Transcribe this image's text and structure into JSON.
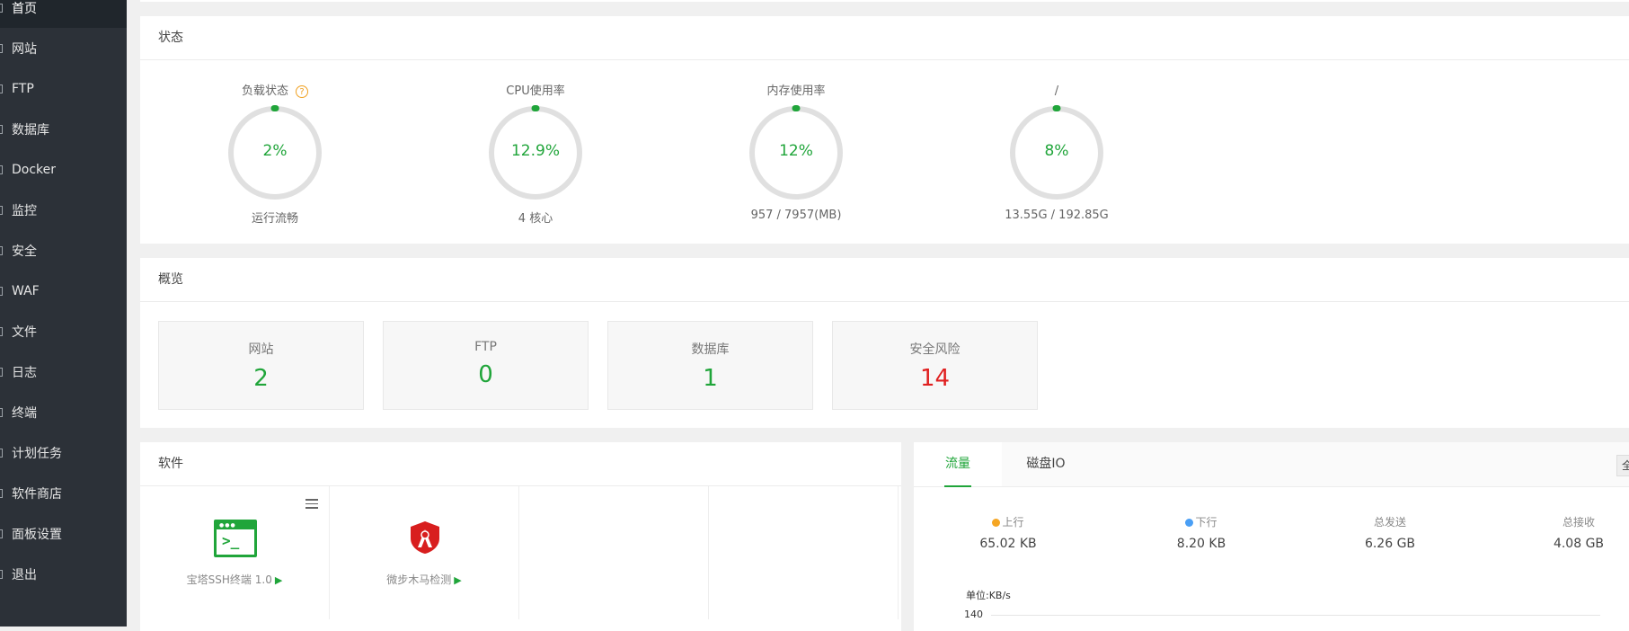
{
  "sidebar": {
    "items": [
      {
        "label": "首页",
        "active": true
      },
      {
        "label": "网站"
      },
      {
        "label": "FTP"
      },
      {
        "label": "数据库"
      },
      {
        "label": "Docker"
      },
      {
        "label": "监控"
      },
      {
        "label": "安全"
      },
      {
        "label": "WAF"
      },
      {
        "label": "文件"
      },
      {
        "label": "日志"
      },
      {
        "label": "终端"
      },
      {
        "label": "计划任务"
      },
      {
        "label": "软件商店"
      },
      {
        "label": "面板设置"
      },
      {
        "label": "退出"
      }
    ]
  },
  "status": {
    "title": "状态",
    "gauges": [
      {
        "title": "负载状态",
        "help": "?",
        "value": "2%",
        "sub": "运行流畅"
      },
      {
        "title": "CPU使用率",
        "value": "12.9%",
        "sub": "4 核心"
      },
      {
        "title": "内存使用率",
        "value": "12%",
        "sub": "957 / 7957(MB)"
      },
      {
        "title": "/",
        "value": "8%",
        "sub": "13.55G / 192.85G"
      }
    ]
  },
  "overview": {
    "title": "概览",
    "boxes": [
      {
        "label": "网站",
        "value": "2"
      },
      {
        "label": "FTP",
        "value": "0"
      },
      {
        "label": "数据库",
        "value": "1"
      },
      {
        "label": "安全风险",
        "value": "14",
        "color": "#e02020"
      }
    ]
  },
  "software": {
    "title": "软件",
    "items": [
      {
        "name": "宝塔SSH终端 1.0",
        "icon": "terminal-icon"
      },
      {
        "name": "微步木马检测",
        "icon": "shield-icon"
      }
    ]
  },
  "traffic": {
    "tabs": [
      "流量",
      "磁盘IO"
    ],
    "corner": "全",
    "stats": [
      {
        "label": "上行",
        "value": "65.02 KB",
        "bullet": "#f5a623"
      },
      {
        "label": "下行",
        "value": "8.20 KB",
        "bullet": "#4a9ff5"
      },
      {
        "label": "总发送",
        "value": "6.26 GB"
      },
      {
        "label": "总接收",
        "value": "4.08 GB"
      }
    ],
    "unit": "单位:KB/s",
    "tick": "140"
  },
  "colors": {
    "accent": "#20a53a",
    "danger": "#e02020",
    "sidebar": "#2c3138"
  }
}
